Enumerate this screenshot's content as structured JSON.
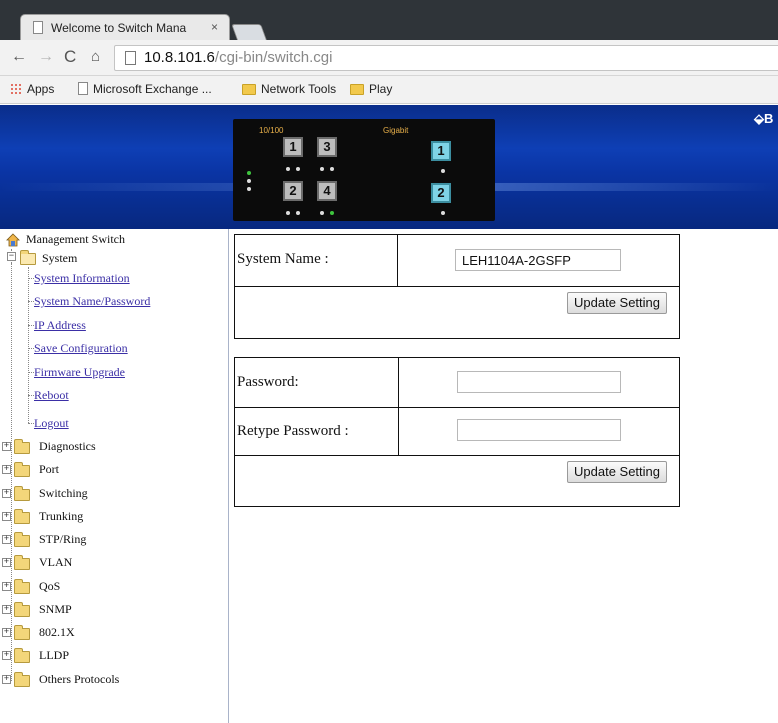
{
  "browser": {
    "tab_title": "Welcome to Switch Mana",
    "tab_close": "×",
    "url_host": "10.8.101.6",
    "url_path": "/cgi-bin/switch.cgi"
  },
  "bookmarks": [
    {
      "label": "Apps",
      "icon": "apps-icon"
    },
    {
      "label": "Microsoft Exchange ...",
      "icon": "page-icon"
    },
    {
      "label": "Network Tools",
      "icon": "folder-icon"
    },
    {
      "label": "Play",
      "icon": "folder-icon"
    }
  ],
  "panel": {
    "label_10_100": "10/100",
    "label_gigabit": "Gigabit",
    "ports": [
      "1",
      "3",
      "2",
      "4"
    ],
    "giga_ports": [
      "1",
      "2"
    ]
  },
  "logo_text": "B",
  "sidebar": {
    "root": "Management Switch",
    "system": "System",
    "system_items": [
      "System Information",
      "System Name/Password",
      "IP Address",
      "Save Configuration",
      "Firmware Upgrade",
      "Reboot",
      "Logout"
    ],
    "folders": [
      "Diagnostics",
      "Port",
      "Switching",
      "Trunking",
      "STP/Ring",
      "VLAN",
      "QoS",
      "SNMP",
      "802.1X",
      "LLDP",
      "Others Protocols"
    ]
  },
  "form1": {
    "system_name_label": "System Name :",
    "system_name_value": "LEH1104A-2GSFP",
    "update_button": "Update Setting"
  },
  "form2": {
    "password_label": "Password:",
    "retype_label": "Retype Password :",
    "password_value": "",
    "retype_value": "",
    "update_button": "Update Setting"
  }
}
